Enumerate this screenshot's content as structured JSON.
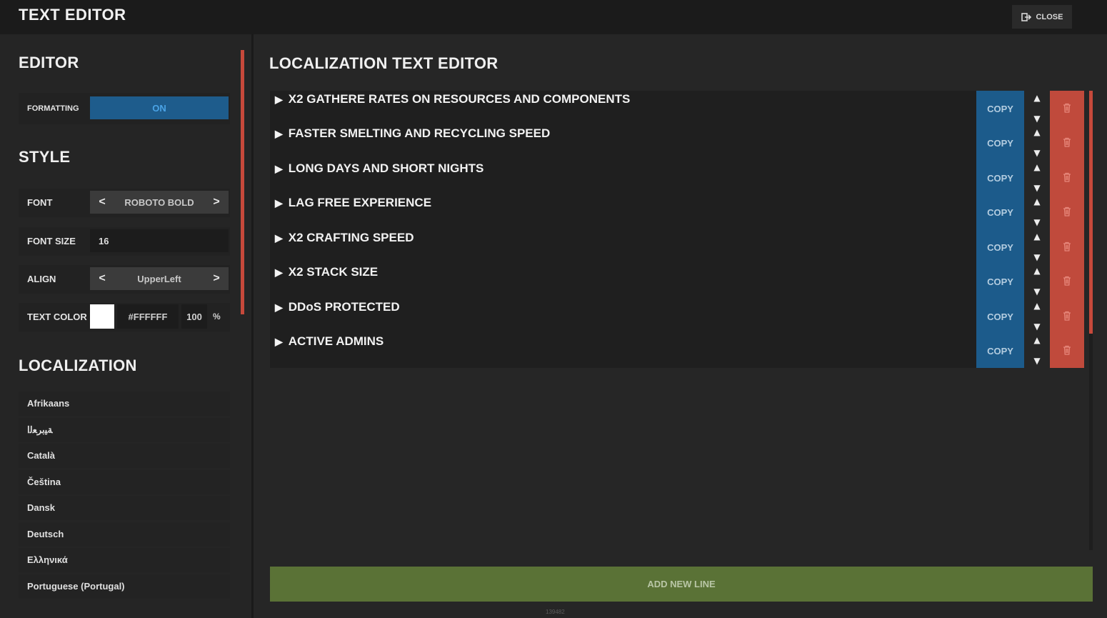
{
  "app_title": "TEXT EDITOR",
  "close_label": "CLOSE",
  "sidebar": {
    "editor_title": "EDITOR",
    "formatting_label": "FORMATTING",
    "formatting_value": "ON",
    "style_title": "STYLE",
    "font_label": "FONT",
    "font_value": "ROBOTO BOLD",
    "font_size_label": "FONT SIZE",
    "font_size_value": "16",
    "align_label": "ALIGN",
    "align_value": "UpperLeft",
    "text_color_label": "TEXT COLOR",
    "text_color_hex": "#FFFFFF",
    "text_color_alpha": "100",
    "percent_sign": "%",
    "prev_symbol": "<",
    "next_symbol": ">",
    "localization_title": "LOCALIZATION",
    "languages": [
      "Afrikaans",
      "ﺔﻴﺑﺮﻌﻟا",
      "Català",
      "Čeština",
      "Dansk",
      "Deutsch",
      "Ελληνικά",
      "Portuguese (Portugal)"
    ]
  },
  "main": {
    "title": "LOCALIZATION TEXT EDITOR",
    "lines": [
      "X2 GATHERE RATES ON RESOURCES AND COMPONENTS",
      "FASTER SMELTING AND RECYCLING SPEED",
      "LONG DAYS AND SHORT NIGHTS",
      "LAG FREE EXPERIENCE",
      "X2 CRAFTING SPEED",
      "X2 STACK SIZE",
      "DDoS PROTECTED",
      "ACTIVE ADMINS"
    ],
    "copy_label": "COPY",
    "add_line_label": "ADD NEW LINE",
    "footer_code": "139482"
  },
  "colors": {
    "accent_blue": "#1c5b8b",
    "danger_red": "#c04a3c",
    "add_green": "#5a7236",
    "background": "#262626"
  },
  "icons": {
    "close": "exit-icon",
    "expand": "triangle-right-icon",
    "move_up": "arrow-up-icon",
    "move_down": "arrow-down-icon",
    "delete": "trash-icon"
  }
}
